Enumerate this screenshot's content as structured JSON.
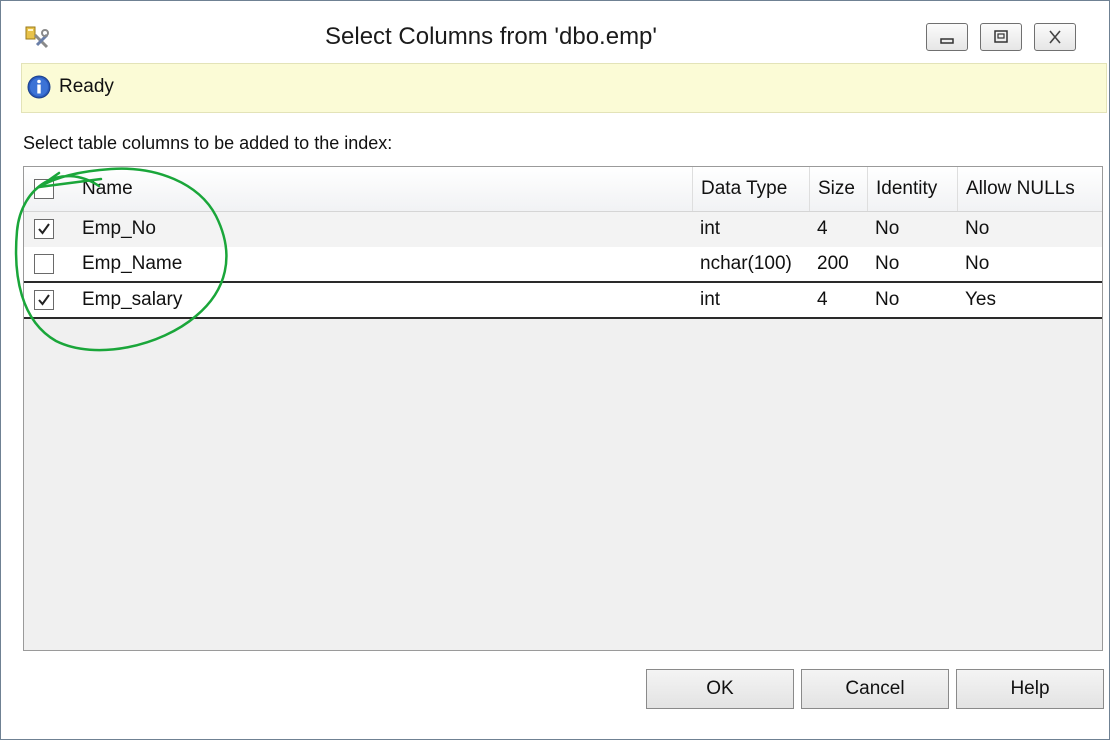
{
  "window": {
    "title": "Select Columns from 'dbo.emp'"
  },
  "status": {
    "text": "Ready",
    "icon": "info-icon"
  },
  "instruction": "Select table columns to be added to the index:",
  "grid": {
    "headers": {
      "name": "Name",
      "data_type": "Data Type",
      "size": "Size",
      "identity": "Identity",
      "allow_nulls": "Allow NULLs"
    },
    "select_all_checked": false,
    "rows": [
      {
        "checked": true,
        "name": "Emp_No",
        "data_type": "int",
        "size": "4",
        "identity": "No",
        "allow_nulls": "No"
      },
      {
        "checked": false,
        "name": "Emp_Name",
        "data_type": "nchar(100)",
        "size": "200",
        "identity": "No",
        "allow_nulls": "No"
      },
      {
        "checked": true,
        "name": "Emp_salary",
        "data_type": "int",
        "size": "4",
        "identity": "No",
        "allow_nulls": "Yes"
      }
    ]
  },
  "buttons": {
    "ok": "OK",
    "cancel": "Cancel",
    "help": "Help"
  },
  "colors": {
    "status_bg": "#fbfbd6",
    "annotation": "#1aa63a",
    "info_blue": "#2a5bbf"
  }
}
